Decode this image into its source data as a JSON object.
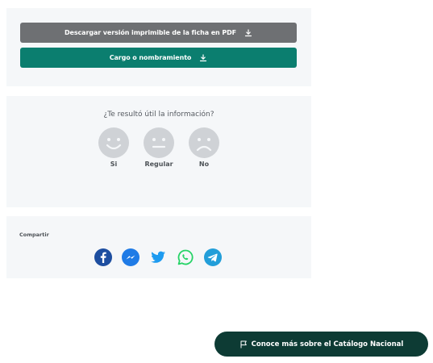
{
  "download": {
    "pdf_label": "Descargar versión imprimible de la ficha en PDF",
    "cargo_label": "Cargo o nombramiento"
  },
  "feedback": {
    "question": "¿Te resultó útil la información?",
    "options": [
      {
        "label": "Si",
        "icon": "smile-face-icon"
      },
      {
        "label": "Regular",
        "icon": "neutral-face-icon"
      },
      {
        "label": "No",
        "icon": "sad-face-icon"
      }
    ]
  },
  "share": {
    "title": "Compartir",
    "networks": [
      {
        "icon": "facebook-icon",
        "color": "#1d4ea0"
      },
      {
        "icon": "messenger-icon",
        "color": "#1f7be6"
      },
      {
        "icon": "twitter-icon",
        "color": "#1d9bf0"
      },
      {
        "icon": "whatsapp-icon",
        "color": "#25d366"
      },
      {
        "icon": "telegram-icon",
        "color": "#229ed9"
      }
    ]
  },
  "catalog_button": {
    "label": "Conoce más sobre el Catálogo Nacional",
    "icon": "flag-icon"
  },
  "colors": {
    "card_bg": "#f5f7f9",
    "pdf_button": "#6e7073",
    "cargo_button": "#0b7e6f",
    "catalog_button": "#0d3b34",
    "face_gray": "#cfd2d6"
  }
}
